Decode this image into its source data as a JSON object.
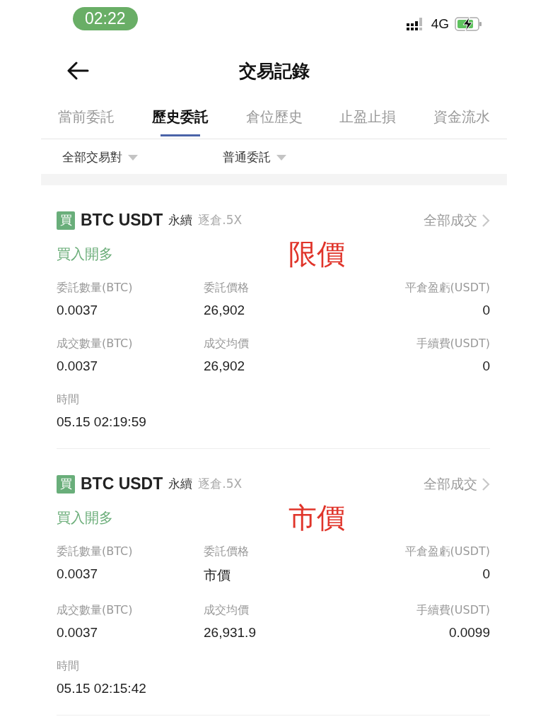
{
  "status_bar": {
    "time": "02:22",
    "network": "4G"
  },
  "header": {
    "title": "交易記錄"
  },
  "tabs": [
    {
      "label": "當前委託",
      "selected": false
    },
    {
      "label": "歷史委託",
      "selected": true
    },
    {
      "label": "倉位歷史",
      "selected": false
    },
    {
      "label": "止盈止損",
      "selected": false
    },
    {
      "label": "資金流水",
      "selected": false
    }
  ],
  "filters": [
    {
      "label": "全部交易對"
    },
    {
      "label": "普通委託"
    }
  ],
  "orders": [
    {
      "badge": "買",
      "symbol": "BTC USDT",
      "contract": "永續",
      "margin": "逐倉.5X",
      "link": "全部成交",
      "side": "買入開多",
      "annotation": "限價",
      "fields": [
        {
          "label": "委託數量(BTC)",
          "value": "0.0037"
        },
        {
          "label": "委託價格",
          "value": "26,902"
        },
        {
          "label": "平倉盈虧(USDT)",
          "value": "0"
        },
        {
          "label": "成交數量(BTC)",
          "value": "0.0037"
        },
        {
          "label": "成交均價",
          "value": "26,902"
        },
        {
          "label": "手續費(USDT)",
          "value": "0"
        },
        {
          "label": "時間",
          "value": "05.15 02:19:59"
        }
      ]
    },
    {
      "badge": "買",
      "symbol": "BTC USDT",
      "contract": "永續",
      "margin": "逐倉.5X",
      "link": "全部成交",
      "side": "買入開多",
      "annotation": "市價",
      "fields": [
        {
          "label": "委託數量(BTC)",
          "value": "0.0037"
        },
        {
          "label": "委託價格",
          "value": "市價"
        },
        {
          "label": "平倉盈虧(USDT)",
          "value": "0"
        },
        {
          "label": "成交數量(BTC)",
          "value": "0.0037"
        },
        {
          "label": "成交均價",
          "value": "26,931.9"
        },
        {
          "label": "手續費(USDT)",
          "value": "0.0099"
        },
        {
          "label": "時間",
          "value": "05.15 02:15:42"
        }
      ]
    }
  ]
}
